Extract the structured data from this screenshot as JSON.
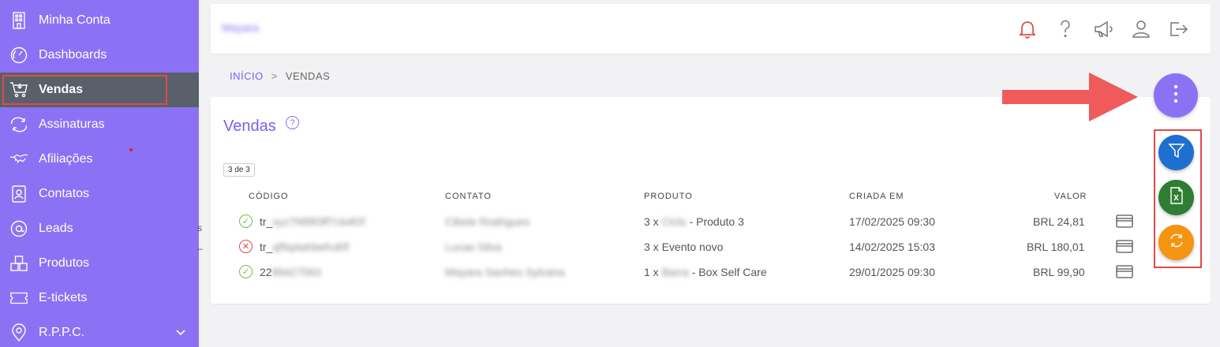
{
  "sidebar": {
    "items": [
      {
        "label": "Minha Conta",
        "icon": "building-icon"
      },
      {
        "label": "Dashboards",
        "icon": "gauge-icon"
      },
      {
        "label": "Vendas",
        "icon": "cart-icon"
      },
      {
        "label": "Assinaturas",
        "icon": "refresh-icon"
      },
      {
        "label": "Afiliações",
        "icon": "handshake-icon"
      },
      {
        "label": "Contatos",
        "icon": "contact-card-icon"
      },
      {
        "label": "Leads",
        "icon": "at-icon"
      },
      {
        "label": "Produtos",
        "icon": "boxes-icon"
      },
      {
        "label": "E-tickets",
        "icon": "ticket-icon"
      },
      {
        "label": "R.P.P.C.",
        "icon": "map-pin-icon"
      }
    ],
    "active": "Vendas",
    "bg_color": "#8b72f5"
  },
  "header": {
    "brand": "Mayara",
    "icons": [
      "bell-icon",
      "help-icon",
      "megaphone-icon",
      "user-icon",
      "logout-icon"
    ]
  },
  "breadcrumb": {
    "home": "INÍCIO",
    "separator": ">",
    "current": "VENDAS"
  },
  "main": {
    "title": "Vendas",
    "count_badge": "3 de 3",
    "columns": {
      "codigo": "CÓDIGO",
      "contato": "CONTATO",
      "produto": "PRODUTO",
      "criada_em": "CRIADA EM",
      "valor": "VALOR"
    },
    "rows": [
      {
        "status": "ok",
        "codigo_prefix": "tr_",
        "codigo_rest": "xyz7f4f8f3ff7cb4f2f",
        "contato": "Cibele Rodrigues",
        "produto_pre": "3 x",
        "produto_blur": "Ciclo",
        "produto_post": "- Produto 3",
        "data": "17/02/2025 09:30",
        "valor": "BRL 24,81"
      },
      {
        "status": "error",
        "codigo_prefix": "tr_",
        "codigo_rest": "qf9q4ahbefcd0f",
        "contato": "Lucas Silva",
        "produto_pre": "3 x Evento novo",
        "produto_blur": "",
        "produto_post": "",
        "data": "14/02/2025 15:03",
        "valor": "BRL 180,01"
      },
      {
        "status": "ok",
        "codigo_prefix": "22",
        "codigo_rest": "89427563",
        "contato": "Mayara Sanhes Sylvana",
        "produto_pre": "1 x",
        "produto_blur": "Barra",
        "produto_post": "- Box Self Care",
        "data": "29/01/2025 09:30",
        "valor": "BRL 99,90"
      }
    ]
  },
  "fabs": {
    "main": {
      "icon": "more-vertical-icon",
      "color": "#8b72f5"
    },
    "filter": {
      "icon": "filter-icon",
      "color": "#1f6fd1"
    },
    "excel": {
      "icon": "excel-file-icon",
      "color": "#2e7d32"
    },
    "refresh": {
      "icon": "refresh-icon",
      "color": "#f59410"
    }
  },
  "annotation_colors": {
    "arrow": "#f05a5a",
    "highlight": "#e04a4a"
  }
}
